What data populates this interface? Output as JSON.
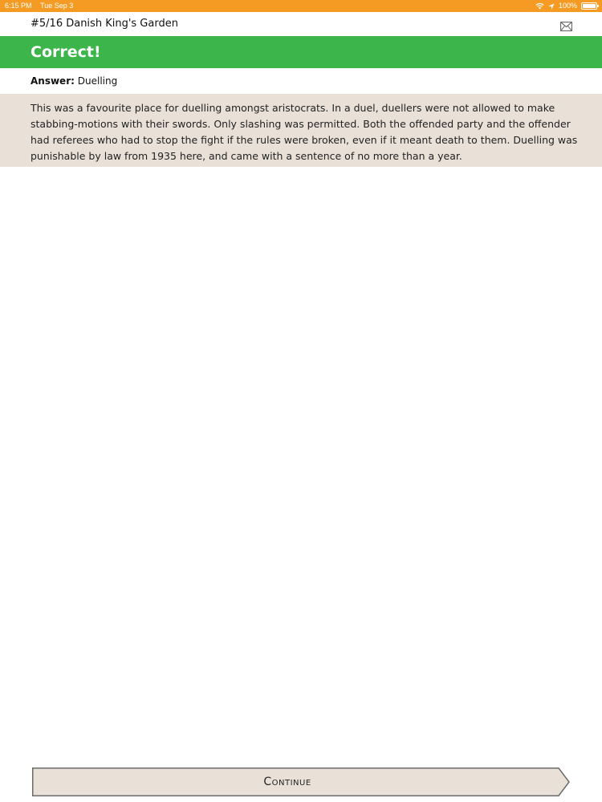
{
  "status_bar": {
    "time": "6:15 PM",
    "date": "Tue Sep 3",
    "battery": "100%",
    "battery_level": 1.0
  },
  "header": {
    "title": "#5/16 Danish King's Garden",
    "mail_icon": "envelope-icon"
  },
  "result": {
    "title": "Correct!",
    "color": "#3cb54a"
  },
  "answer": {
    "label": "Answer:",
    "value": "Duelling"
  },
  "explanation": {
    "text": "This was a favourite place for duelling amongst aristocrats. In a duel, duellers were not allowed to make stabbing-motions with their swords. Only slashing was permitted. Both the offended party and the offender had referees who had to stop the fight if the rules were broken, even if it meant death to them. Duelling was punishable by law from 1935 here, and came with a sentence of no more than a year.",
    "background": "#e9e1d8"
  },
  "footer": {
    "continue_label": "Continue"
  },
  "colors": {
    "status_bar": "#f59b23",
    "accent_green": "#3cb54a",
    "panel_beige": "#e9e1d8"
  }
}
